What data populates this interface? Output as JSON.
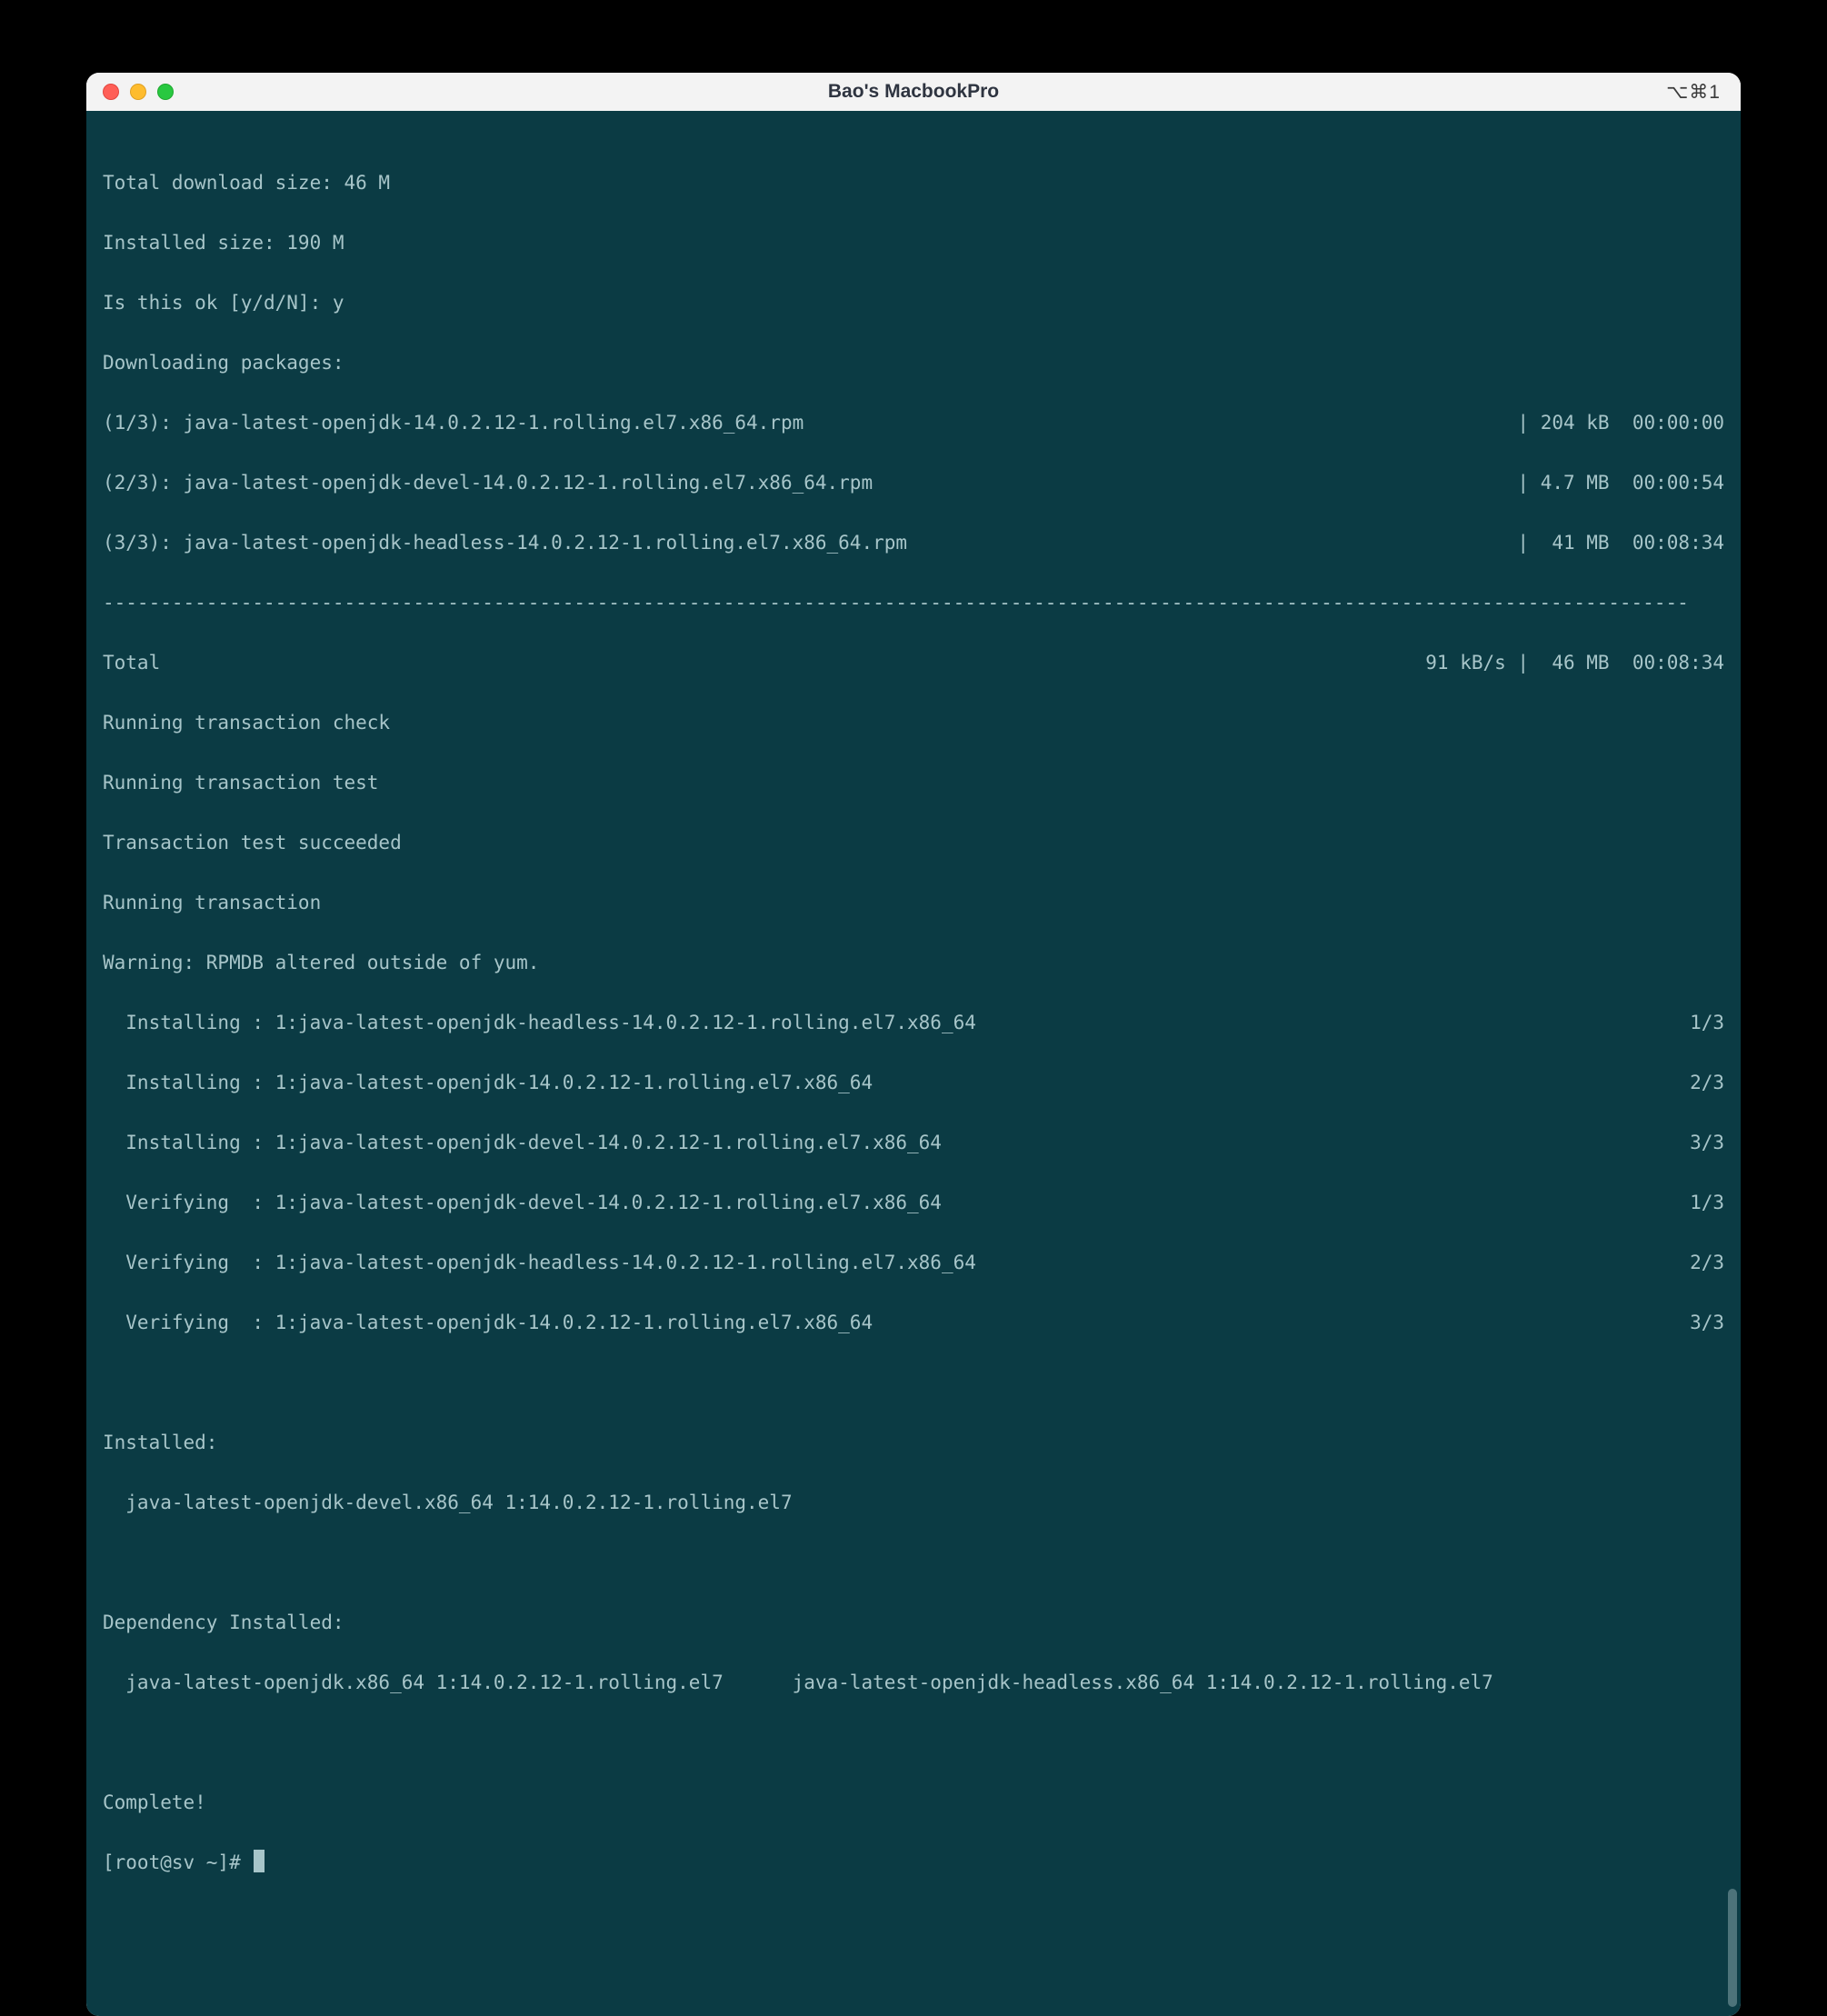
{
  "window": {
    "title": "Bao's MacbookPro",
    "shortcut": "⌥⌘1"
  },
  "terminal": {
    "download_size": "Total download size: 46 M",
    "installed_size": "Installed size: 190 M",
    "prompt_ok": "Is this ok [y/d/N]: y",
    "downloading": "Downloading packages:",
    "pkg1_left": "(1/3): java-latest-openjdk-14.0.2.12-1.rolling.el7.x86_64.rpm",
    "pkg1_right": "| 204 kB  00:00:00",
    "pkg2_left": "(2/3): java-latest-openjdk-devel-14.0.2.12-1.rolling.el7.x86_64.rpm",
    "pkg2_right": "| 4.7 MB  00:00:54",
    "pkg3_left": "(3/3): java-latest-openjdk-headless-14.0.2.12-1.rolling.el7.x86_64.rpm",
    "pkg3_right": "|  41 MB  00:08:34",
    "total_left": "Total",
    "total_right": "91 kB/s |  46 MB  00:08:34",
    "run_check": "Running transaction check",
    "run_test": "Running transaction test",
    "test_succeeded": "Transaction test succeeded",
    "run_trans": "Running transaction",
    "warning": "Warning: RPMDB altered outside of yum.",
    "inst1_left": "  Installing : 1:java-latest-openjdk-headless-14.0.2.12-1.rolling.el7.x86_64",
    "inst1_right": "1/3",
    "inst2_left": "  Installing : 1:java-latest-openjdk-14.0.2.12-1.rolling.el7.x86_64",
    "inst2_right": "2/3",
    "inst3_left": "  Installing : 1:java-latest-openjdk-devel-14.0.2.12-1.rolling.el7.x86_64",
    "inst3_right": "3/3",
    "ver1_left": "  Verifying  : 1:java-latest-openjdk-devel-14.0.2.12-1.rolling.el7.x86_64",
    "ver1_right": "1/3",
    "ver2_left": "  Verifying  : 1:java-latest-openjdk-headless-14.0.2.12-1.rolling.el7.x86_64",
    "ver2_right": "2/3",
    "ver3_left": "  Verifying  : 1:java-latest-openjdk-14.0.2.12-1.rolling.el7.x86_64",
    "ver3_right": "3/3",
    "installed_hdr": "Installed:",
    "installed_pkg": "  java-latest-openjdk-devel.x86_64 1:14.0.2.12-1.rolling.el7",
    "dep_hdr": "Dependency Installed:",
    "dep_pkgs": "  java-latest-openjdk.x86_64 1:14.0.2.12-1.rolling.el7      java-latest-openjdk-headless.x86_64 1:14.0.2.12-1.rolling.el7",
    "complete": "Complete!",
    "prompt": "[root@sv ~]# "
  }
}
